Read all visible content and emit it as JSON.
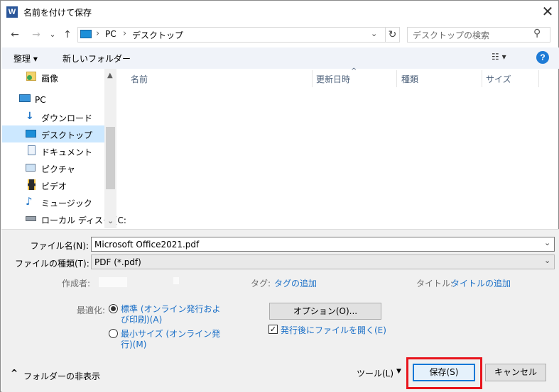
{
  "window": {
    "app_icon": "W",
    "title": "名前を付けて保存",
    "close_glyph": "✕"
  },
  "nav_buttons": {
    "back": "←",
    "forward": "→",
    "recent": "⌄",
    "up": "↑"
  },
  "address": {
    "crumbs": [
      "PC",
      "デスクトップ"
    ],
    "separator": "›",
    "dropdown_glyph": "⌄",
    "refresh_glyph": "↻"
  },
  "search": {
    "placeholder": "デスクトップの検索",
    "icon_glyph": "⚲"
  },
  "toolbar": {
    "organize": "整理 ▾",
    "new_folder": "新しいフォルダー",
    "view_glyph": "☷ ▾",
    "help_glyph": "?"
  },
  "nav_items": [
    {
      "label": "画像",
      "icon": "pictures-folder-icon"
    },
    {
      "label": "PC",
      "icon": "pc-icon"
    },
    {
      "label": "ダウンロード",
      "icon": "download-icon"
    },
    {
      "label": "デスクトップ",
      "icon": "desktop-icon",
      "selected": true
    },
    {
      "label": "ドキュメント",
      "icon": "document-icon"
    },
    {
      "label": "ピクチャ",
      "icon": "picture-icon"
    },
    {
      "label": "ビデオ",
      "icon": "video-icon"
    },
    {
      "label": "ミュージック",
      "icon": "music-icon"
    },
    {
      "label": "ローカル ディスク (C:",
      "icon": "drive-icon"
    }
  ],
  "nav_scroll": {
    "up": "▲",
    "down": "⌄"
  },
  "columns": {
    "name": "名前",
    "date": "更新日時",
    "type": "種類",
    "size": "サイズ",
    "sort_glyph": "^"
  },
  "filename": {
    "label": "ファイル名(N):",
    "value": "Microsoft Office2021.pdf",
    "dd": "⌄"
  },
  "filetype": {
    "label": "ファイルの種類(T):",
    "value": "PDF (*.pdf)",
    "dd": "⌄"
  },
  "meta": {
    "author_label": "作成者:",
    "tag_label": "タグ:",
    "tag_link": "タグの追加",
    "title_label": "タイトル:",
    "title_link": "タイトルの追加"
  },
  "optimize": {
    "label": "最適化:",
    "standard_line1": "標準 (オンライン発行およ",
    "standard_line2": "び印刷)(A)",
    "minimum_line1": "最小サイズ (オンライン発",
    "minimum_line2": "行)(M)",
    "selected": "standard"
  },
  "options_button": "オプション(O)...",
  "open_after": {
    "label": "発行後にファイルを開く(E)",
    "checked": true,
    "glyph": "✓"
  },
  "footer": {
    "hide_folders": "フォルダーの非表示",
    "hide_glyph": "^",
    "tools": "ツール(L)",
    "tools_glyph": "▼",
    "save": "保存(S)",
    "cancel": "キャンセル"
  },
  "colors": {
    "accent": "#0078d7",
    "highlight": "#e8141c",
    "link": "#1a6fc7",
    "selected_bg": "#cce8ff"
  }
}
